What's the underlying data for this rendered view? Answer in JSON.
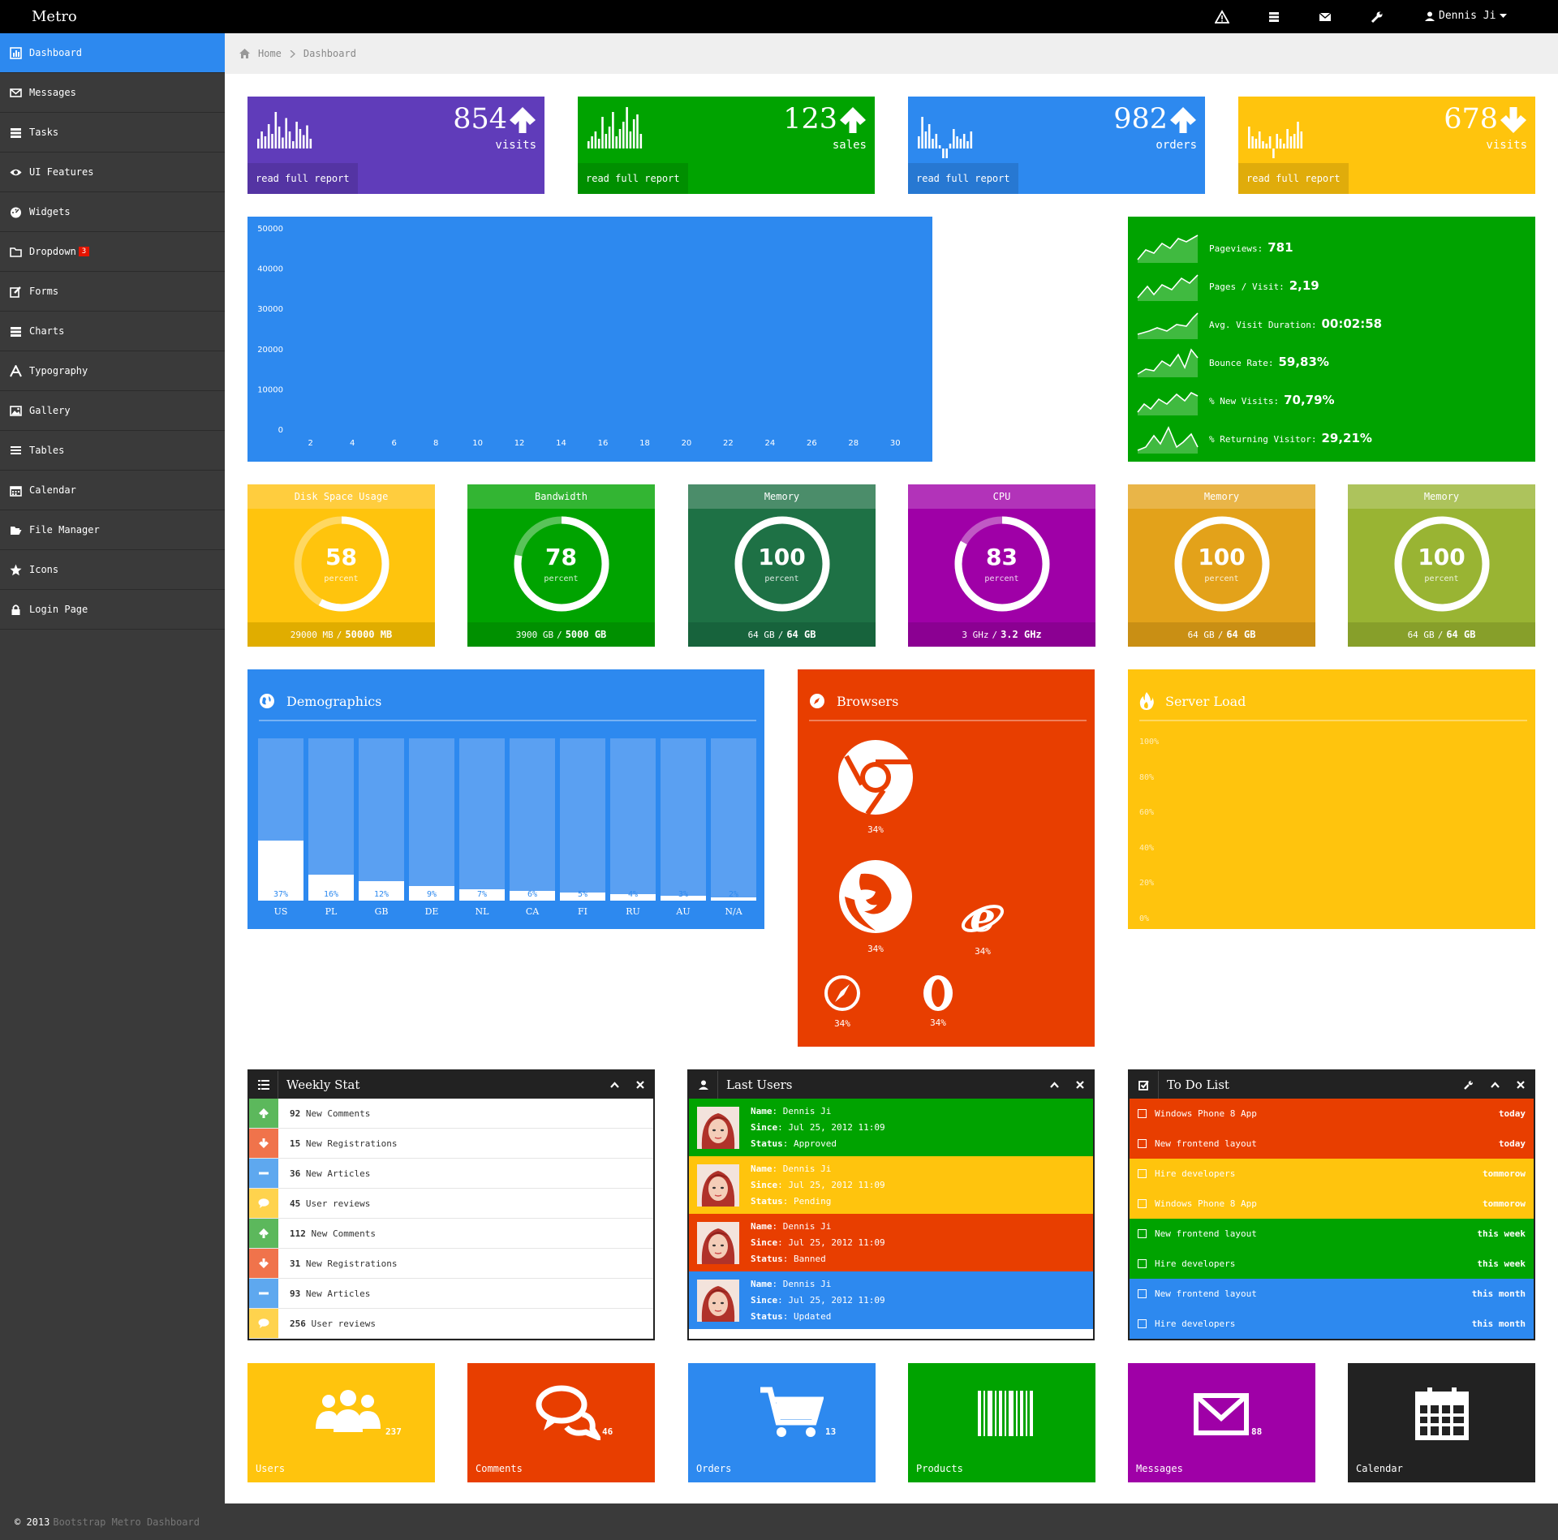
{
  "app": {
    "brand": "Metro"
  },
  "topbar": {
    "user": "Dennis Ji"
  },
  "sidebar": {
    "items": [
      {
        "label": "Dashboard",
        "icon": "chart-bar-icon"
      },
      {
        "label": "Messages",
        "icon": "envelope-icon"
      },
      {
        "label": "Tasks",
        "icon": "tasks-icon"
      },
      {
        "label": "UI Features",
        "icon": "eye-icon"
      },
      {
        "label": "Widgets",
        "icon": "dashboard-icon"
      },
      {
        "label": "Dropdown",
        "icon": "folder-icon",
        "badge": "3"
      },
      {
        "label": "Forms",
        "icon": "edit-icon"
      },
      {
        "label": "Charts",
        "icon": "list-icon"
      },
      {
        "label": "Typography",
        "icon": "font-icon"
      },
      {
        "label": "Gallery",
        "icon": "picture-icon"
      },
      {
        "label": "Tables",
        "icon": "align-icon"
      },
      {
        "label": "Calendar",
        "icon": "calendar-icon"
      },
      {
        "label": "File Manager",
        "icon": "folder-open-icon"
      },
      {
        "label": "Icons",
        "icon": "star-icon"
      },
      {
        "label": "Login Page",
        "icon": "lock-icon"
      }
    ]
  },
  "breadcrumb": {
    "home": "Home",
    "current": "Dashboard"
  },
  "stats": [
    {
      "value": "854",
      "label": "visits",
      "link": "read full report",
      "color": "#603cba",
      "trend": "up"
    },
    {
      "value": "123",
      "label": "sales",
      "link": "read full report",
      "color": "#00a300",
      "trend": "up"
    },
    {
      "value": "982",
      "label": "orders",
      "link": "read full report",
      "color": "#2d89ef",
      "trend": "up"
    },
    {
      "value": "678",
      "label": "visits",
      "link": "read full report",
      "color": "#ffc40d",
      "trend": "down"
    }
  ],
  "chart_data": {
    "type": "line",
    "title": "",
    "xlabel": "",
    "ylabel": "",
    "x_ticks": [
      "2",
      "4",
      "6",
      "8",
      "10",
      "12",
      "14",
      "16",
      "18",
      "20",
      "22",
      "24",
      "26",
      "28",
      "30"
    ],
    "y_ticks": [
      "50000",
      "40000",
      "30000",
      "20000",
      "10000",
      "0"
    ],
    "ylim": [
      0,
      50000
    ],
    "xlim": [
      1,
      31
    ],
    "series": []
  },
  "site_stats": [
    {
      "label": "Pageviews:",
      "value": "781"
    },
    {
      "label": "Pages / Visit:",
      "value": "2,19"
    },
    {
      "label": "Avg. Visit Duration:",
      "value": "00:02:58"
    },
    {
      "label": "Bounce Rate:",
      "value": "59,83%"
    },
    {
      "label": "% New Visits:",
      "value": "70,79%"
    },
    {
      "label": "% Returning Visitor:",
      "value": "29,21%"
    }
  ],
  "circle_stats": [
    {
      "title": "Disk Space Usage",
      "value": "58",
      "unit": "percent",
      "pct": 0.58,
      "used": "29000 MB",
      "total": "50000 MB",
      "color": "#ffc40d",
      "head": "#ffcd3e",
      "foot": "#e0ad00"
    },
    {
      "title": "Bandwidth",
      "value": "78",
      "unit": "percent",
      "pct": 0.78,
      "used": "3900 GB",
      "total": "5000 GB",
      "color": "#00a300",
      "head": "#33b533",
      "foot": "#009000"
    },
    {
      "title": "Memory",
      "value": "100",
      "unit": "percent",
      "pct": 1.0,
      "used": "64 GB",
      "total": "64 GB",
      "color": "#1e7145",
      "head": "#4b8d6a",
      "foot": "#17633c"
    },
    {
      "title": "CPU",
      "value": "83",
      "unit": "percent",
      "pct": 0.83,
      "used": "3 GHz",
      "total": "3.2 GHz",
      "color": "#9f00a7",
      "head": "#b233b9",
      "foot": "#8b0092"
    },
    {
      "title": "Memory",
      "value": "100",
      "unit": "percent",
      "pct": 1.0,
      "used": "64 GB",
      "total": "64 GB",
      "color": "#e3a21a",
      "head": "#e9b548",
      "foot": "#c98f14"
    },
    {
      "title": "Memory",
      "value": "100",
      "unit": "percent",
      "pct": 1.0,
      "used": "64 GB",
      "total": "64 GB",
      "color": "#99b433",
      "head": "#adc35c",
      "foot": "#879f2a"
    }
  ],
  "demographics": {
    "title": "Demographics",
    "countries": [
      {
        "code": "US",
        "pct": "37%",
        "value": 37
      },
      {
        "code": "PL",
        "pct": "16%",
        "value": 16
      },
      {
        "code": "GB",
        "pct": "12%",
        "value": 12
      },
      {
        "code": "DE",
        "pct": "9%",
        "value": 9
      },
      {
        "code": "NL",
        "pct": "7%",
        "value": 7
      },
      {
        "code": "CA",
        "pct": "6%",
        "value": 6
      },
      {
        "code": "FI",
        "pct": "5%",
        "value": 5
      },
      {
        "code": "RU",
        "pct": "4%",
        "value": 4
      },
      {
        "code": "AU",
        "pct": "3%",
        "value": 3
      },
      {
        "code": "N/A",
        "pct": "2%",
        "value": 2
      }
    ]
  },
  "browsers": {
    "title": "Browsers",
    "items": [
      {
        "name": "chrome",
        "pct": "34%"
      },
      {
        "name": "firefox",
        "pct": "34%"
      },
      {
        "name": "ie",
        "pct": "34%"
      },
      {
        "name": "safari",
        "pct": "34%"
      },
      {
        "name": "opera",
        "pct": "34%"
      }
    ]
  },
  "server_load": {
    "title": "Server Load",
    "y_ticks": [
      "100%",
      "80%",
      "60%",
      "40%",
      "20%",
      "0%"
    ]
  },
  "weekly_stat": {
    "title": "Weekly Stat",
    "rows": [
      {
        "count": "92",
        "text": "New Comments",
        "kind": "up",
        "color": "#5cb85c"
      },
      {
        "count": "15",
        "text": "New Registrations",
        "kind": "down",
        "color": "#f0734b"
      },
      {
        "count": "36",
        "text": "New Articles",
        "kind": "minus",
        "color": "#5ea8ef"
      },
      {
        "count": "45",
        "text": "User reviews",
        "kind": "comment",
        "color": "#ffd34d"
      },
      {
        "count": "112",
        "text": "New Comments",
        "kind": "up",
        "color": "#5cb85c"
      },
      {
        "count": "31",
        "text": "New Registrations",
        "kind": "down",
        "color": "#f0734b"
      },
      {
        "count": "93",
        "text": "New Articles",
        "kind": "minus",
        "color": "#5ea8ef"
      },
      {
        "count": "256",
        "text": "User reviews",
        "kind": "comment",
        "color": "#ffd34d"
      }
    ]
  },
  "last_users": {
    "title": "Last Users",
    "labels": {
      "name": "Name",
      "since": "Since",
      "status": "Status"
    },
    "rows": [
      {
        "name": "Dennis Ji",
        "since": "Jul 25, 2012 11:09",
        "status": "Approved",
        "color": "#00a300"
      },
      {
        "name": "Dennis Ji",
        "since": "Jul 25, 2012 11:09",
        "status": "Pending",
        "color": "#ffc40d"
      },
      {
        "name": "Dennis Ji",
        "since": "Jul 25, 2012 11:09",
        "status": "Banned",
        "color": "#e83e00"
      },
      {
        "name": "Dennis Ji",
        "since": "Jul 25, 2012 11:09",
        "status": "Updated",
        "color": "#2d89ef"
      }
    ]
  },
  "todo": {
    "title": "To Do List",
    "rows": [
      {
        "text": "Windows Phone 8 App",
        "when": "today",
        "color": "#e83e00"
      },
      {
        "text": "New frontend layout",
        "when": "today",
        "color": "#e83e00"
      },
      {
        "text": "Hire developers",
        "when": "tommorow",
        "color": "#ffc40d"
      },
      {
        "text": "Windows Phone 8 App",
        "when": "tommorow",
        "color": "#ffc40d"
      },
      {
        "text": "New frontend layout",
        "when": "this week",
        "color": "#00a300"
      },
      {
        "text": "Hire developers",
        "when": "this week",
        "color": "#00a300"
      },
      {
        "text": "New frontend layout",
        "when": "this month",
        "color": "#2d89ef"
      },
      {
        "text": "Hire developers",
        "when": "this month",
        "color": "#2d89ef"
      }
    ]
  },
  "tiles": [
    {
      "label": "Users",
      "count": "237",
      "color": "#ffc40d",
      "icon": "users-icon"
    },
    {
      "label": "Comments",
      "count": "46",
      "color": "#e83e00",
      "icon": "comments-icon"
    },
    {
      "label": "Orders",
      "count": "13",
      "color": "#2d89ef",
      "icon": "cart-icon"
    },
    {
      "label": "Products",
      "count": "",
      "color": "#00a300",
      "icon": "barcode-icon"
    },
    {
      "label": "Messages",
      "count": "88",
      "color": "#9f00a7",
      "icon": "envelope-icon"
    },
    {
      "label": "Calendar",
      "count": "",
      "color": "#222222",
      "icon": "calendar-icon"
    }
  ],
  "footer": {
    "copyright": "© 2013",
    "link": "Bootstrap Metro Dashboard"
  }
}
